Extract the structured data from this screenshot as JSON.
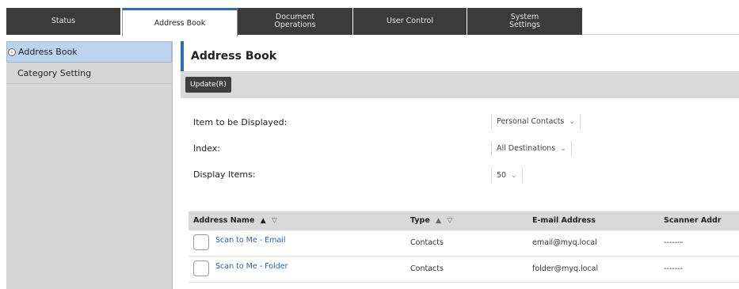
{
  "tabs": [
    {
      "label": "Status"
    },
    {
      "label": "Address Book"
    },
    {
      "label": "Document\nOperations"
    },
    {
      "label": "User Control"
    },
    {
      "label": "System\nSettings"
    }
  ],
  "sidebar": {
    "items": [
      {
        "label": "Address Book",
        "active": true
      },
      {
        "label": "Category Setting",
        "active": false
      }
    ]
  },
  "main": {
    "title": "Address Book",
    "update_button": "Update(R)",
    "form": {
      "item_label": "Item to be Displayed:",
      "item_value": "Personal Contacts",
      "index_label": "Index:",
      "index_value": "All Destinations",
      "display_label": "Display Items:",
      "display_value": "50"
    },
    "table": {
      "headers": {
        "name": "Address Name",
        "type": "Type",
        "email": "E-mail Address",
        "scanner": "Scanner Addr"
      },
      "rows": [
        {
          "name": "Scan to Me - Email",
          "type": "Contacts",
          "email": "email@myq.local",
          "scanner": "-------"
        },
        {
          "name": "Scan to Me - Folder",
          "type": "Contacts",
          "email": "folder@myq.local",
          "scanner": "-------"
        }
      ]
    }
  },
  "colors": {
    "accent": "#2a6fb0",
    "tab_dark": "#3b3b3b",
    "sidebar_bg": "#d6d6d6",
    "sidebar_active": "#bcd3ec",
    "link": "#2a5fb0"
  }
}
